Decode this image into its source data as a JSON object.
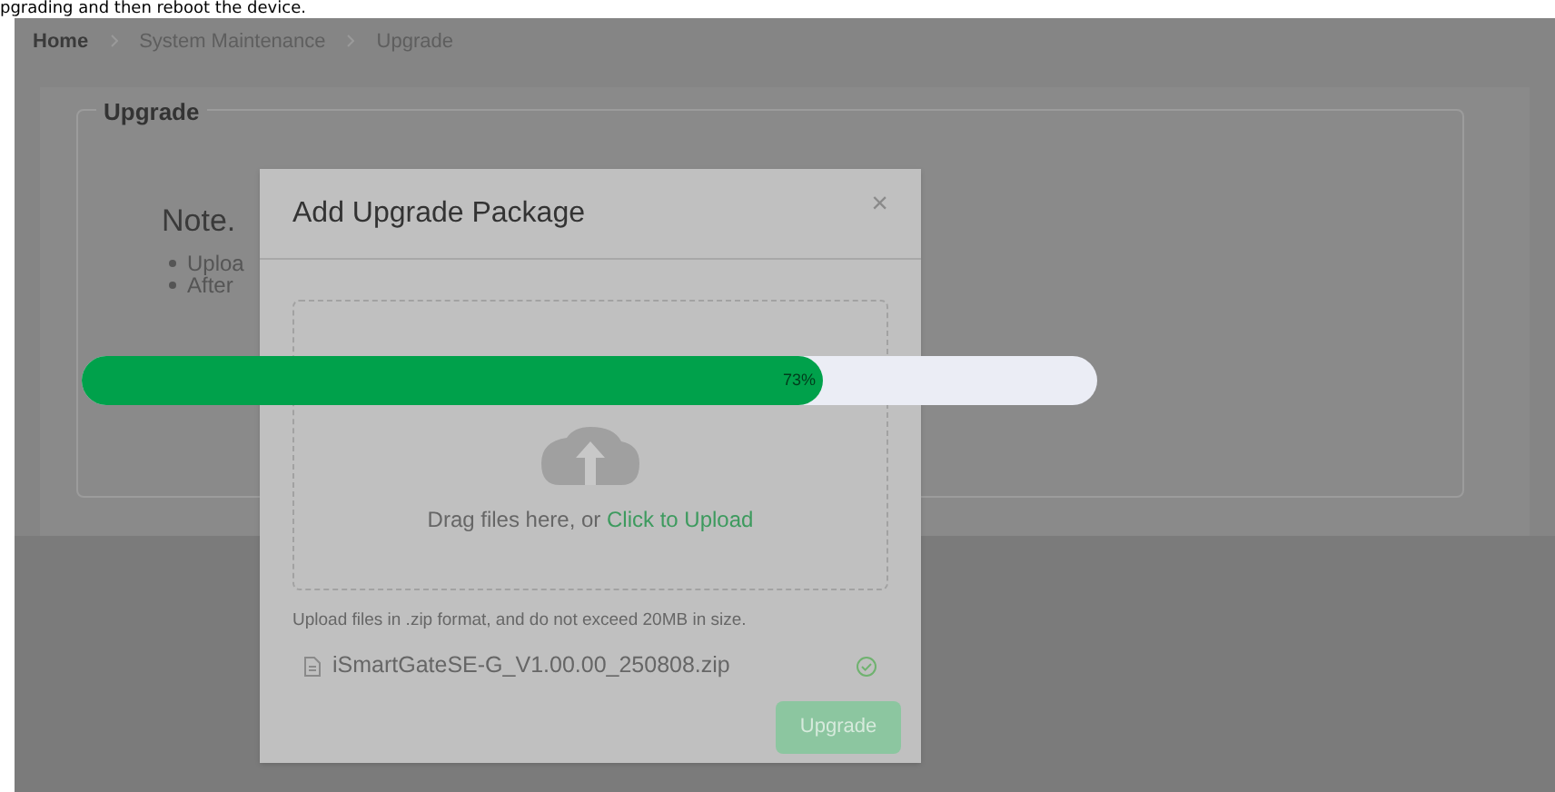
{
  "doc_text": "pgrading and then reboot the device.",
  "breadcrumb": [
    {
      "label": "Home",
      "selected": true
    },
    {
      "label": "System Maintenance",
      "selected": false
    },
    {
      "label": "Upgrade",
      "selected": false
    }
  ],
  "section": {
    "title": "Upgrade",
    "note_title": "Note.",
    "bullets": [
      "Uploa",
      "After"
    ]
  },
  "dialog": {
    "title": "Add Upgrade Package",
    "close": "×",
    "drop_text": "Drag files here, or ",
    "drop_link": "Click to Upload",
    "hint": "Upload files in .zip format, and do not exceed 20MB in size.",
    "file": {
      "name": "iSmartGateSE-G_V1.00.00_250808.zip",
      "done": true
    },
    "button": {
      "label": "Upgrade",
      "disabled": true
    }
  },
  "progress": {
    "level": 0.73,
    "reading": "73%"
  }
}
